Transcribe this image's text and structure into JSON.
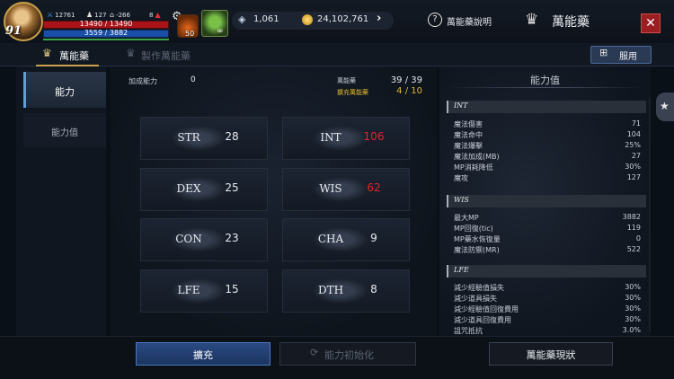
{
  "hud": {
    "level": "91",
    "mini_stats": [
      "12761",
      "127",
      "-266",
      "8"
    ],
    "hp": "13490 / 13490",
    "mp": "3559 / 3882",
    "potion_count": "50",
    "leaf_count": "∞",
    "gems": "1,061",
    "gold": "24,102,761",
    "help_label": "萬能藥說明",
    "title": "萬能藥",
    "close": "✕"
  },
  "tabs": {
    "tab1": "萬能藥",
    "tab2": "製作萬能藥",
    "use_button": "服用"
  },
  "left_menu": {
    "ability": "能力",
    "stats": "能力值"
  },
  "center": {
    "added_label": "加成能力",
    "added_value": "0",
    "potion_label": "萬能藥",
    "potion_value": "39 / 39",
    "expansion_label": "擴充萬能藥",
    "expansion_value": "4 / 10",
    "stats": [
      {
        "name": "STR",
        "value": "28"
      },
      {
        "name": "INT",
        "value": "106"
      },
      {
        "name": "DEX",
        "value": "25"
      },
      {
        "name": "WIS",
        "value": "62"
      },
      {
        "name": "CON",
        "value": "23"
      },
      {
        "name": "CHA",
        "value": "9"
      },
      {
        "name": "LFE",
        "value": "15"
      },
      {
        "name": "DTH",
        "value": "8"
      }
    ]
  },
  "right": {
    "title": "能力值",
    "sections": [
      {
        "name": "INT",
        "rows": [
          {
            "label": "魔法傷害",
            "value": "71"
          },
          {
            "label": "魔法命中",
            "value": "104"
          },
          {
            "label": "魔法爆擊",
            "value": "25%"
          },
          {
            "label": "魔法加成(MB)",
            "value": "27"
          },
          {
            "label": "MP消耗降低",
            "value": "30%"
          },
          {
            "label": "魔攻",
            "value": "127"
          }
        ]
      },
      {
        "name": "WIS",
        "rows": [
          {
            "label": "最大MP",
            "value": "3882"
          },
          {
            "label": "MP回復(tic)",
            "value": "119"
          },
          {
            "label": "MP藥水恢復量",
            "value": "0"
          },
          {
            "label": "魔法防禦(MR)",
            "value": "522"
          }
        ]
      },
      {
        "name": "LFE",
        "rows": [
          {
            "label": "減少經驗值損失",
            "value": "30%"
          },
          {
            "label": "減少道具損失",
            "value": "30%"
          },
          {
            "label": "減少經驗值回復費用",
            "value": "30%"
          },
          {
            "label": "減少道具回復費用",
            "value": "30%"
          },
          {
            "label": "詛咒抵抗",
            "value": "3.0%"
          }
        ]
      }
    ]
  },
  "bottom": {
    "expand": "擴充",
    "reset": "能力初始化",
    "status": "萬能藥現狀"
  }
}
